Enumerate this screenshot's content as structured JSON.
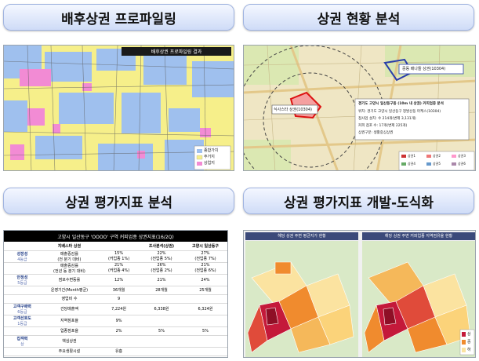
{
  "sections": [
    {
      "title": "배후상권 프로파일링"
    },
    {
      "title": "상권 현황 분석"
    },
    {
      "title": "상권 평가지표 분석"
    },
    {
      "title": "상권 평가지표 개발-도식화"
    }
  ],
  "panel1": {
    "header": "배후상권 프로파일링 결과",
    "legend": [
      "종합가치",
      "주거지",
      "상업지"
    ]
  },
  "panel2": {
    "label_top": "중동 배나들 상권(10304)",
    "label_left": "식사스타 상권(10304)",
    "info_title": "경기도 고양시 일산동구동 (10m 내 상권) 커피업종 분석",
    "info_lines": [
      "위치: 경기도 고양시 일산동구 정발산동 마케스(10304)",
      "점사업 설치: 수 214개(변제 3,131개)",
      "커피 점포 수: 17개(변제 225개)",
      "상권구분: 생활중심상권"
    ],
    "legend": [
      "상권1",
      "상권2",
      "상권3",
      "상권4",
      "상권5",
      "상권6"
    ]
  },
  "panel3": {
    "title": "고양시 일산동구 'OOOO' 구역 커피업종 상권지표(16/2Q)",
    "col_headers": [
      "지배스타 상권",
      "",
      "조사분석(상권)",
      "고양시 일산동구"
    ],
    "rows": [
      {
        "cat": "성장성",
        "grade": "4등급",
        "metric": "매출증감률\n(전 분기 대비)",
        "sub": "15%\n(커업종 1%)",
        "a": "22%\n(전업종 5%)",
        "b": "27%\n(전업종 7%)"
      },
      {
        "cat": "",
        "grade": "",
        "metric": "매출증감률\n(전년 동 분기 대비)",
        "sub": "21%\n(커업종 4%)",
        "a": "26%\n(전업종 2%)",
        "b": "21%\n(전업종 6%)"
      },
      {
        "cat": "안정성",
        "grade": "5등급",
        "metric": "점포수변동률",
        "sub": "12%",
        "a": "21%",
        "b": "24%"
      },
      {
        "cat": "",
        "grade": "",
        "metric": "운영기간(Month평균)",
        "sub": "36개월",
        "a": "28개월",
        "b": "25개월"
      },
      {
        "cat": "",
        "grade": "",
        "metric": "영업비 수",
        "sub": "9",
        "a": "",
        "b": ""
      },
      {
        "cat": "고객구매력",
        "grade": "6등급",
        "metric": "건당매출액",
        "sub": "7,224원",
        "a": "6,338원",
        "b": "6,324원"
      },
      {
        "cat": "고객선호도",
        "grade": "1등급",
        "metric": "지역점포율",
        "sub": "9%",
        "a": "",
        "b": ""
      },
      {
        "cat": "",
        "grade": "",
        "metric": "업종점포율",
        "sub": "2%",
        "a": "5%",
        "b": "5%"
      },
      {
        "cat": "집객력",
        "grade": "상",
        "metric": "핵심상권",
        "sub": "",
        "a": "",
        "b": ""
      },
      {
        "cat": "",
        "grade": "",
        "metric": "주요생활시설",
        "sub": "유흥",
        "a": "",
        "b": ""
      }
    ]
  },
  "panel4": {
    "left_title": "해당 상권 주변 평균지가 현황",
    "right_title": "해당 상권 주변 커피업종 지역점유율 현황",
    "legend": [
      "상",
      "중",
      "하"
    ]
  },
  "colors": {
    "pill_top": "#f4f7ff",
    "pill_bottom": "#cfdcf7",
    "residential": "#f5e86a",
    "commercial": "#f28bd4",
    "blue_zone": "#9fc0ee",
    "heat_high": "#c4193a",
    "heat_mid": "#f08b2e",
    "heat_low": "#fbe3a0"
  }
}
